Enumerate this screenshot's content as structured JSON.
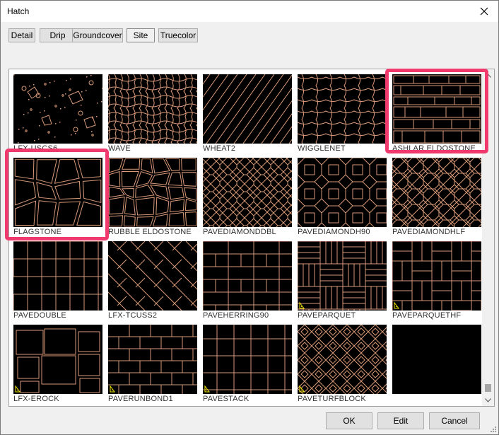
{
  "window": {
    "title": "Hatch"
  },
  "tabs": [
    "Detail",
    "Drip",
    "Groundcover",
    "Site",
    "Truecolor"
  ],
  "active_tab": "Site",
  "patterns": [
    "LFX-USCS6",
    "WAVE",
    "WHEAT2",
    "WIGGLENET",
    "ASHLAR ELDOSTONE",
    "FLAGSTONE",
    "RUBBLE ELDOSTONE",
    "PAVEDIAMONDDBL",
    "PAVEDIAMONDH90",
    "PAVEDIAMONDHLF",
    "PAVEDOUBLE",
    "LFX-TCUSS2",
    "PAVEHERRING90",
    "PAVEPARQUET",
    "PAVEPARQUETHF",
    "LFX-EROCK",
    "PAVERUNBOND1",
    "PAVESTACK",
    "PAVETURFBLOCK",
    ""
  ],
  "highlighted": [
    "ASHLAR ELDOSTONE",
    "FLAGSTONE"
  ],
  "buttons": {
    "ok": "OK",
    "edit": "Edit",
    "cancel": "Cancel"
  },
  "colors": {
    "pattern_line": "#d89a7a",
    "highlight": "#f03a6e",
    "warning_marker": "#f2e600"
  }
}
